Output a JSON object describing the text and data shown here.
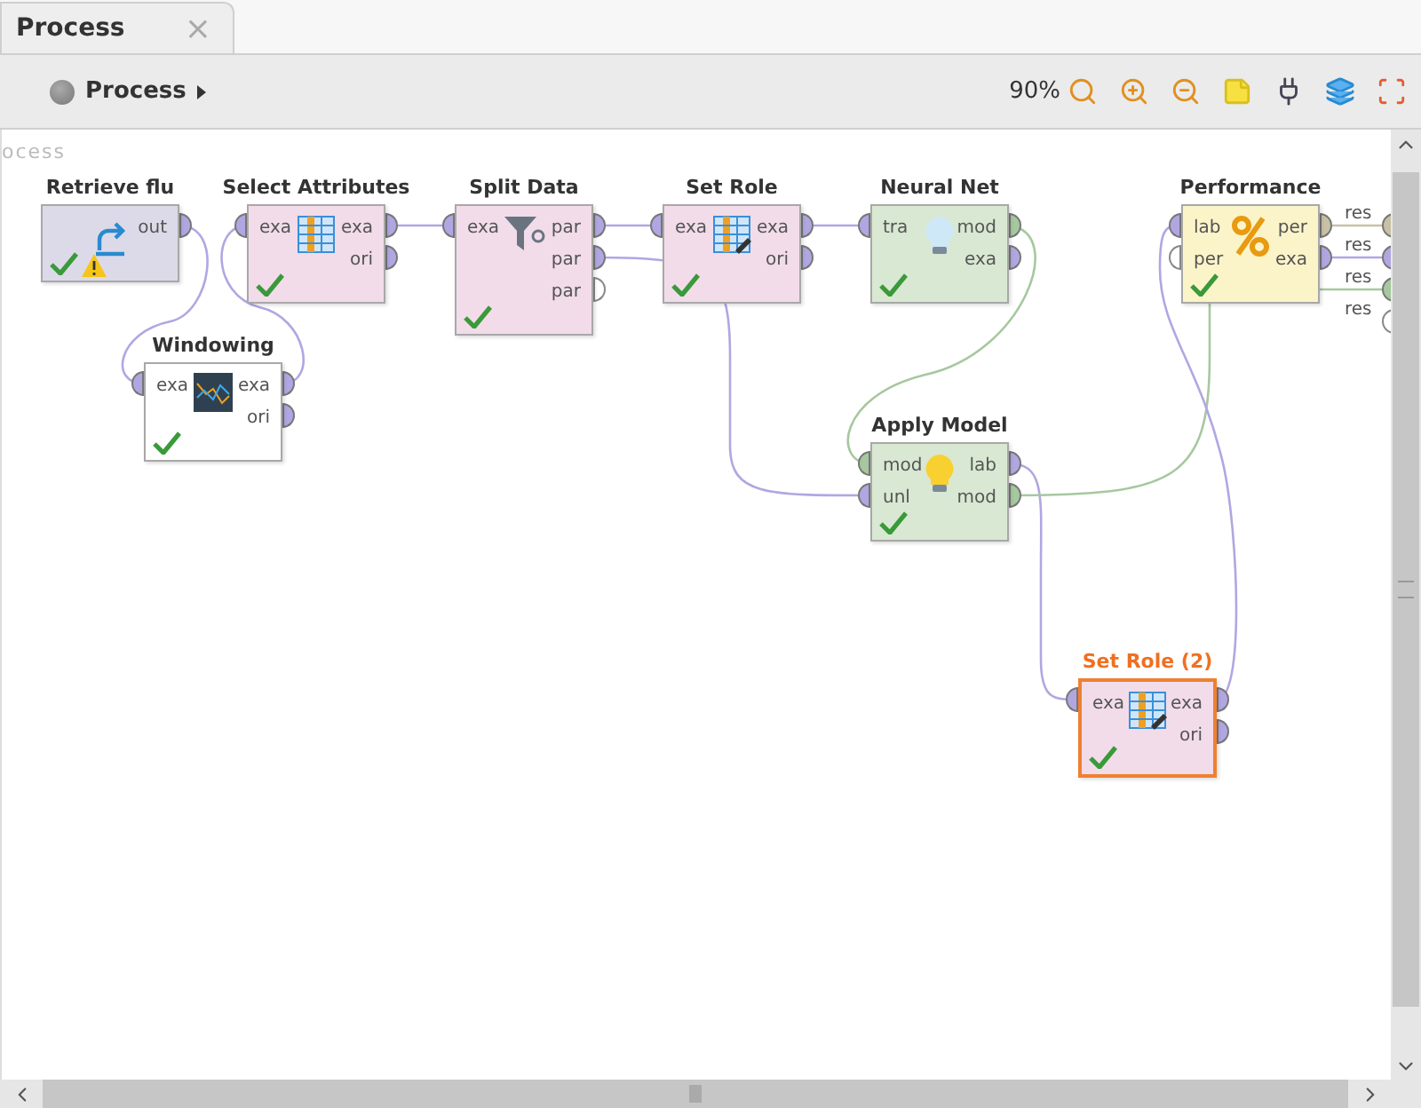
{
  "tab": {
    "label": "Process",
    "close": "×"
  },
  "breadcrumb": {
    "label": "Process"
  },
  "toolbar": {
    "zoom": "90%"
  },
  "canvas": {
    "label": "ocess"
  },
  "operators": [
    {
      "name": "Retrieve flu",
      "kind": "retrieve",
      "color": "#dcdae8",
      "selected": false,
      "warning": true,
      "outputs": [
        {
          "label": "out",
          "kind": "data",
          "connected": true
        }
      ]
    },
    {
      "name": "Select Attributes",
      "kind": "select",
      "color": "#f2dcea",
      "selected": false,
      "warning": false,
      "inputs": [
        {
          "label": "exa",
          "kind": "data",
          "connected": true
        }
      ],
      "outputs": [
        {
          "label": "exa",
          "kind": "data",
          "connected": true
        },
        {
          "label": "ori",
          "kind": "data",
          "connected": true
        }
      ]
    },
    {
      "name": "Split Data",
      "kind": "split",
      "color": "#f2dcea",
      "selected": false,
      "warning": false,
      "inputs": [
        {
          "label": "exa",
          "kind": "data",
          "connected": true
        }
      ],
      "outputs": [
        {
          "label": "par",
          "kind": "data",
          "connected": true
        },
        {
          "label": "par",
          "kind": "data",
          "connected": true
        },
        {
          "label": "par",
          "kind": "data",
          "connected": false
        }
      ]
    },
    {
      "name": "Set Role",
      "kind": "role",
      "color": "#f2dcea",
      "selected": false,
      "warning": false,
      "inputs": [
        {
          "label": "exa",
          "kind": "data",
          "connected": true
        }
      ],
      "outputs": [
        {
          "label": "exa",
          "kind": "data",
          "connected": true
        },
        {
          "label": "ori",
          "kind": "data",
          "connected": true
        }
      ]
    },
    {
      "name": "Neural Net",
      "kind": "learner",
      "color": "#d9e8d2",
      "selected": false,
      "warning": false,
      "inputs": [
        {
          "label": "tra",
          "kind": "data",
          "connected": true
        }
      ],
      "outputs": [
        {
          "label": "mod",
          "kind": "model",
          "connected": true
        },
        {
          "label": "exa",
          "kind": "data",
          "connected": true
        }
      ]
    },
    {
      "name": "Performance",
      "kind": "performance",
      "color": "#fcf4c9",
      "selected": false,
      "warning": false,
      "inputs": [
        {
          "label": "lab",
          "kind": "data",
          "connected": true
        },
        {
          "label": "per",
          "kind": "performance",
          "connected": false
        }
      ],
      "outputs": [
        {
          "label": "per",
          "kind": "performance",
          "connected": true
        },
        {
          "label": "exa",
          "kind": "data",
          "connected": true
        }
      ]
    },
    {
      "name": "Windowing",
      "kind": "windowing",
      "color": "#ffffff",
      "selected": false,
      "warning": false,
      "inputs": [
        {
          "label": "exa",
          "kind": "data",
          "connected": true
        }
      ],
      "outputs": [
        {
          "label": "exa",
          "kind": "data",
          "connected": true
        },
        {
          "label": "ori",
          "kind": "data",
          "connected": true
        }
      ]
    },
    {
      "name": "Apply Model",
      "kind": "apply",
      "color": "#d9e8d2",
      "selected": false,
      "warning": false,
      "inputs": [
        {
          "label": "mod",
          "kind": "model",
          "connected": true
        },
        {
          "label": "unl",
          "kind": "data",
          "connected": true
        }
      ],
      "outputs": [
        {
          "label": "lab",
          "kind": "data",
          "connected": true
        },
        {
          "label": "mod",
          "kind": "model",
          "connected": true
        }
      ]
    },
    {
      "name": "Set Role (2)",
      "kind": "role",
      "color": "#f2dcea",
      "selected": true,
      "warning": false,
      "inputs": [
        {
          "label": "exa",
          "kind": "data",
          "connected": true
        }
      ],
      "outputs": [
        {
          "label": "exa",
          "kind": "data",
          "connected": true
        },
        {
          "label": "ori",
          "kind": "data",
          "connected": true
        }
      ]
    }
  ],
  "results": [
    {
      "label": "res",
      "kind": "performance",
      "connected": true
    },
    {
      "label": "res",
      "kind": "data",
      "connected": true
    },
    {
      "label": "res",
      "kind": "model",
      "connected": true
    },
    {
      "label": "res",
      "kind": "data",
      "connected": false
    }
  ]
}
